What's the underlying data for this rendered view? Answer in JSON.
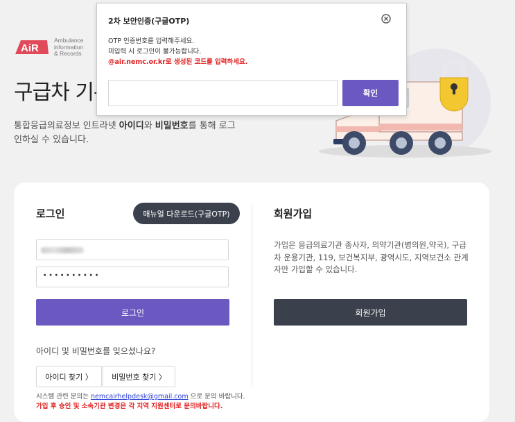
{
  "logo": {
    "mark": "AiR",
    "line1": "Ambulance",
    "line2": "information",
    "line3": "& Records"
  },
  "page": {
    "heading": "구급차 기록",
    "desc_part1": "통합응급의료정보 인트라넷 ",
    "desc_bold1": "아이디",
    "desc_part2": "와 ",
    "desc_bold2": "비밀번호",
    "desc_part3": "를 통해 로그인하실 수 있습니다."
  },
  "login": {
    "title": "로그인",
    "manual_button": "매뉴얼 다운로드(구글OTP)",
    "password_mask": "··········",
    "submit_button": "로그인",
    "forgot_text": "아이디 및 비밀번호를 잊으셨나요?",
    "find_id_button": "아이디 찾기 〉",
    "find_pw_button": "비밀번호 찾기 〉",
    "contact_prefix": "시스템 관련 문의는 ",
    "contact_email": "nemcairhelpdesk@gmail.com",
    "contact_suffix": " 으로 문의 바랍니다.",
    "notice": "가입 후 승인 및 소속기관 변경은 각 지역 지원센터로 문의바랍니다."
  },
  "signup": {
    "title": "회원가입",
    "desc": "가입은 응급의료기관 종사자, 의약기관(병의원,약국), 구급차 운용기관, 119, 보건복지부, 광역시도, 지역보건소 관계자만 가입할 수 있습니다.",
    "button": "회원가입"
  },
  "modal": {
    "title": "2차 보안인증(구글OTP)",
    "line1": "OTP 인증번호를 입력해주세요.",
    "line2": "미입력 시 로그인이 불가능합니다.",
    "warning": "@air.nemc.or.kr로 생성된 코드를 입력하세요.",
    "otp_value": "",
    "otp_placeholder": "",
    "confirm_button": "확인",
    "close_icon": "close-circle-icon"
  },
  "colors": {
    "primary": "#6b58c0",
    "dark": "#3b414c",
    "warning": "#e02020",
    "logo_red": "#e04a5a",
    "background": "#f1f1f1"
  }
}
